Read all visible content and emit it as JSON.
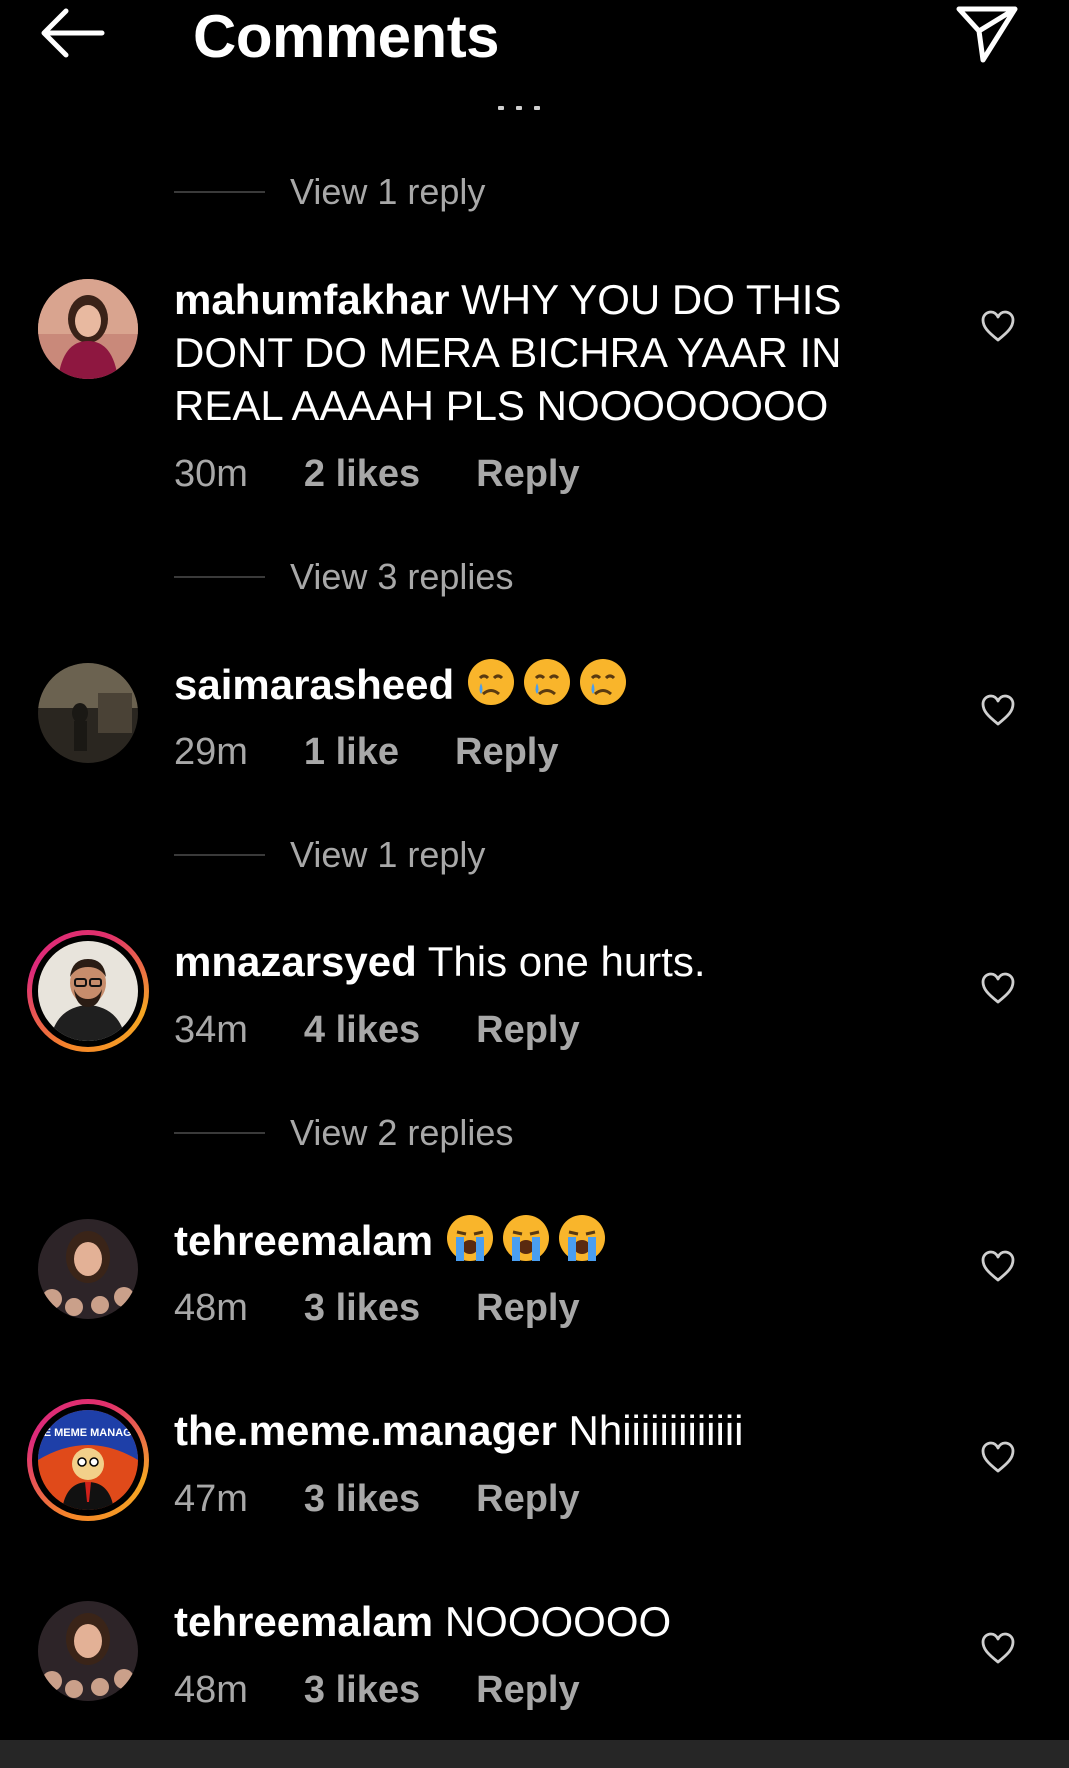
{
  "header": {
    "title": "Comments",
    "back_icon": "arrow-left-icon",
    "send_icon": "paper-plane-icon"
  },
  "colors": {
    "background": "#000000",
    "text": "#ffffff",
    "muted": "#a8a8a8",
    "divider": "#3a3a3a",
    "story_ring_start": "#f58529",
    "story_ring_end": "#dd2a7b"
  },
  "thread": [
    {
      "view_replies": "View 1 reply"
    },
    {
      "username": "mahumfakhar",
      "text": "WHY YOU DO THIS DONT DO MERA BICHRA YAAR IN REAL AAAAH PLS NOOOOOOOO",
      "time": "30m",
      "likes": "2 likes",
      "reply": "Reply",
      "view_replies": "View 3 replies"
    },
    {
      "username": "saimarasheed",
      "emoji": "crying-face-emoji x3",
      "time": "29m",
      "likes": "1 like",
      "reply": "Reply",
      "view_replies": "View 1 reply"
    },
    {
      "username": "mnazarsyed",
      "text": "This one hurts.",
      "time": "34m",
      "likes": "4 likes",
      "reply": "Reply",
      "view_replies": "View 2 replies",
      "story_ring": true
    },
    {
      "username": "tehreemalam",
      "emoji": "loudly-crying-face-emoji x3",
      "time": "48m",
      "likes": "3 likes",
      "reply": "Reply"
    },
    {
      "username": "the.meme.manager",
      "text": "Nhiiiiiiiiiiiii",
      "time": "47m",
      "likes": "3 likes",
      "reply": "Reply",
      "story_ring": true,
      "avatar_text": "THE MEME MANAGER"
    },
    {
      "username": "tehreemalam",
      "text": "NOOOOOO",
      "time": "48m",
      "likes": "3 likes",
      "reply": "Reply"
    }
  ]
}
